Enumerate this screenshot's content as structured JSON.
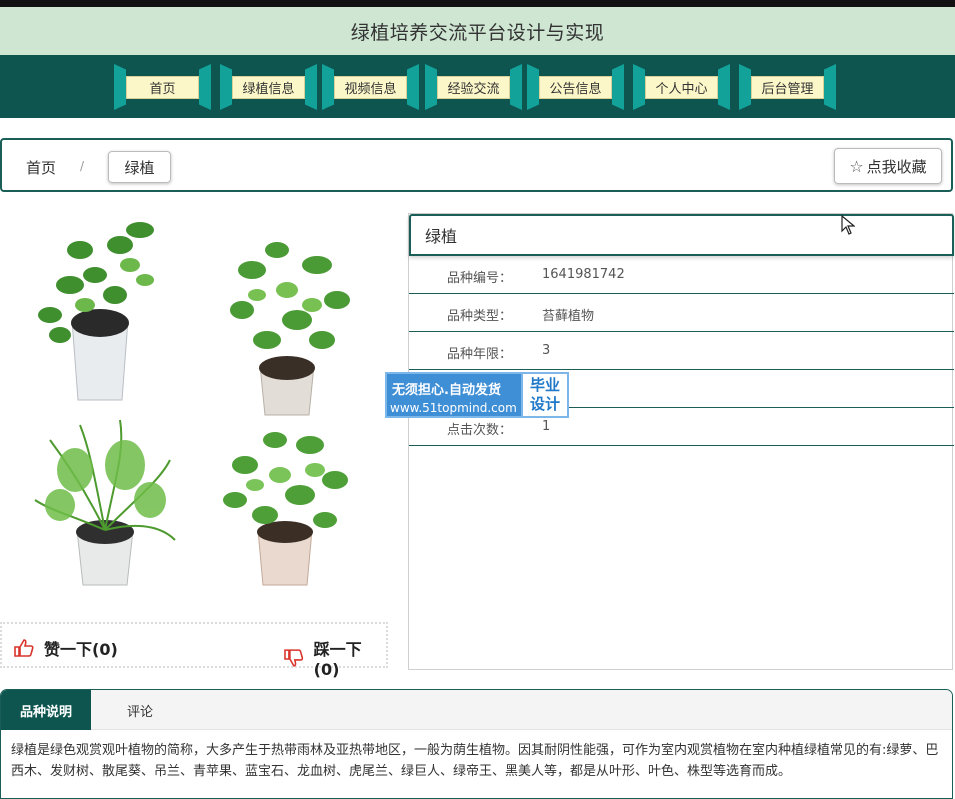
{
  "header": {
    "title": "绿植培养交流平台设计与实现"
  },
  "nav": {
    "items": [
      "首页",
      "绿植信息",
      "视频信息",
      "经验交流",
      "公告信息",
      "个人中心",
      "后台管理"
    ]
  },
  "breadcrumb": {
    "home": "首页",
    "separator": "/",
    "current": "绿植",
    "favorite_label": "点我收藏"
  },
  "detail": {
    "title": "绿植",
    "rows": [
      {
        "key": "品种编号：",
        "value": "1641981742"
      },
      {
        "key": "品种类型：",
        "value": "苔藓植物"
      },
      {
        "key": "品种年限：",
        "value": "3"
      },
      {
        "key": "",
        "value": ""
      },
      {
        "key": "点击次数：",
        "value": "1"
      }
    ]
  },
  "votes": {
    "like_label": "赞一下(0)",
    "dislike_label": "踩一下(0)"
  },
  "watermark": {
    "line1": "无须担心.自动发货",
    "line2": "www.51topmind.com",
    "badge_line1": "毕业",
    "badge_line2": "设计"
  },
  "tabs": {
    "items": [
      "品种说明",
      "评论"
    ],
    "active": "品种说明"
  },
  "description": "绿植是绿色观赏观叶植物的简称，大多产生于热带雨林及亚热带地区，一般为荫生植物。因其耐阴性能强，可作为室内观赏植物在室内种植绿植常见的有:绿萝、巴西木、发财树、散尾葵、吊兰、青苹果、蓝宝石、龙血树、虎尾兰、绿巨人、绿帝王、黑美人等，都是从叶形、叶色、株型等选育而成。",
  "colors": {
    "nav_bg": "#0e5550",
    "title_band": "#cfe6d3",
    "nav_label_bg": "#fbf7c9",
    "accent_teal": "#12a29a",
    "watermark_blue": "#3f8fd6"
  },
  "icons": {
    "favorite": "star-outline-icon",
    "like": "thumbs-up-icon",
    "dislike": "thumbs-down-icon"
  }
}
